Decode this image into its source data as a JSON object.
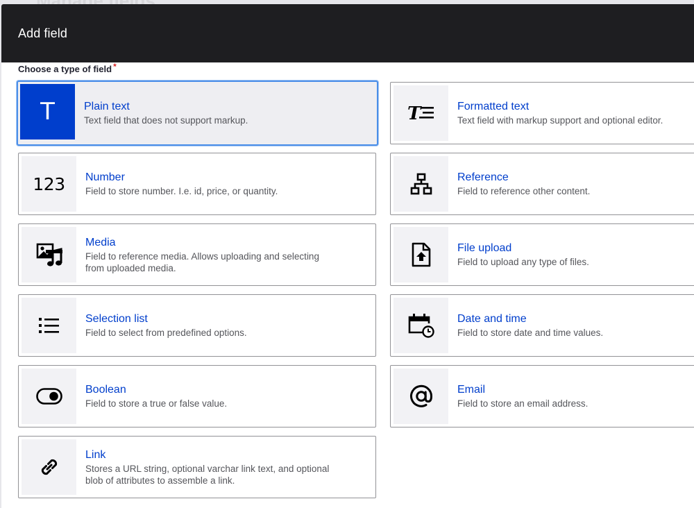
{
  "background": {
    "page_title": "Manage fields"
  },
  "dialog": {
    "title": "Add field",
    "field_label": "Choose a type of field",
    "required_marker": "*"
  },
  "options": [
    {
      "title": "Plain text",
      "desc": "Text field that does not support markup.",
      "icon": "plain-text-icon",
      "selected": true
    },
    {
      "title": "Formatted text",
      "desc": "Text field with markup support and optional editor.",
      "icon": "formatted-text-icon",
      "selected": false
    },
    {
      "title": "Number",
      "desc": "Field to store number. I.e. id, price, or quantity.",
      "icon": "number-icon",
      "selected": false
    },
    {
      "title": "Reference",
      "desc": "Field to reference other content.",
      "icon": "reference-icon",
      "selected": false
    },
    {
      "title": "Media",
      "desc": "Field to reference media. Allows uploading and selecting\nfrom uploaded media.",
      "icon": "media-icon",
      "selected": false
    },
    {
      "title": "File upload",
      "desc": "Field to upload any type of files.",
      "icon": "file-upload-icon",
      "selected": false
    },
    {
      "title": "Selection list",
      "desc": "Field to select from predefined options.",
      "icon": "list-icon",
      "selected": false
    },
    {
      "title": "Date and time",
      "desc": "Field to store date and time values.",
      "icon": "calendar-clock-icon",
      "selected": false
    },
    {
      "title": "Boolean",
      "desc": "Field to store a true or false value.",
      "icon": "toggle-icon",
      "selected": false
    },
    {
      "title": "Email",
      "desc": "Field to store an email address.",
      "icon": "at-sign-icon",
      "selected": false
    },
    {
      "title": "Link",
      "desc": "Stores a URL string, optional varchar link text, and optional\nblob of attributes to assemble a link.",
      "icon": "link-icon",
      "selected": false
    }
  ],
  "icon_glyphs": {
    "plain_text": "T",
    "number": "123"
  },
  "colors": {
    "accent": "#003ecc",
    "header_bg": "#1e1e21",
    "selected_border": "#4a8ee8",
    "required": "#d72222"
  }
}
